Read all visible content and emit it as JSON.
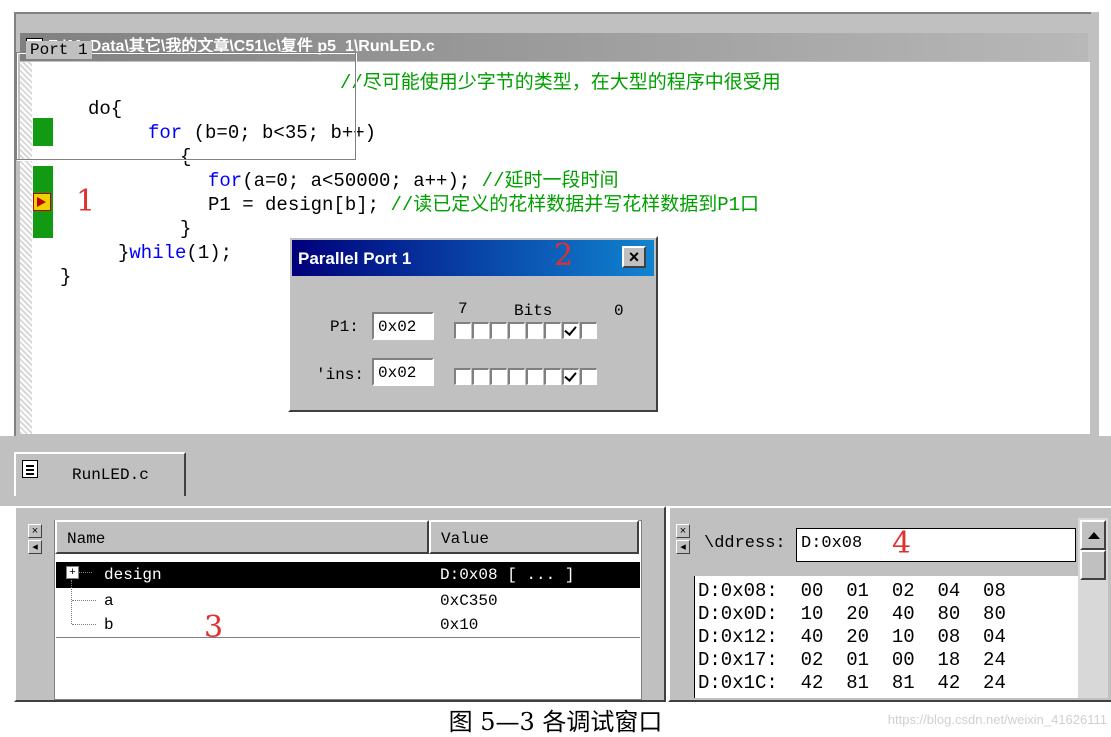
{
  "editor": {
    "title": "F:\\MyData\\其它\\我的文章\\C51\\c\\复件 p5_1\\RunLED.c",
    "lines": {
      "l0_comment": "//尽可能使用少字节的类型，在大型的程序中很受用",
      "l1": "do{",
      "l2_kw": "for",
      "l2_rest": " (b=0; b<35; b++)",
      "l3": "{",
      "l4_kw": "for",
      "l4_rest": "(a=0; a<50000; a++); ",
      "l4_comment": "//延时一段时间",
      "l5_code": "P1 = design[b]; ",
      "l5_comment": "//读已定义的花样数据并写花样数据到P1口",
      "l6": "}",
      "l7_pre": "}",
      "l7_kw": "while",
      "l7_rest": "(1);",
      "l8": "}"
    },
    "tab_label": "RunLED.c"
  },
  "annotations": {
    "a1": "1",
    "a2": "2",
    "a3": "3",
    "a4": "4"
  },
  "parallel_port": {
    "title": "Parallel Port 1",
    "close": "×",
    "group": "Port 1",
    "bits_high": "7",
    "bits_label": "Bits",
    "bits_low": "0",
    "p1_label": "P1:",
    "p1_value": "0x02",
    "pins_label": "'ins:",
    "pins_value": "0x02",
    "p1_bits": [
      0,
      0,
      0,
      0,
      0,
      0,
      1,
      0
    ],
    "pins_bits": [
      0,
      0,
      0,
      0,
      0,
      0,
      1,
      0
    ]
  },
  "watch": {
    "col_name": "Name",
    "col_value": "Value",
    "rows": [
      {
        "name": "design",
        "value": "D:0x08 [ ... ]"
      },
      {
        "name": "a",
        "value": "0xC350"
      },
      {
        "name": "b",
        "value": "0x10"
      }
    ]
  },
  "memory": {
    "address_label": "\\ddress:",
    "address_value": "D:0x08",
    "lines": [
      "D:0x08:  00  01  02  04  08",
      "D:0x0D:  10  20  40  80  80",
      "D:0x12:  40  20  10  08  04",
      "D:0x17:  02  01  00  18  24",
      "D:0x1C:  42  81  81  42  24"
    ]
  },
  "caption": "图 5—3   各调试窗口",
  "watermark": "https://blog.csdn.net/weixin_41626111",
  "colors": {
    "comment": "#00a000",
    "keyword": "#0000ff",
    "annotation": "#e03030",
    "gutter": "#139a13"
  }
}
